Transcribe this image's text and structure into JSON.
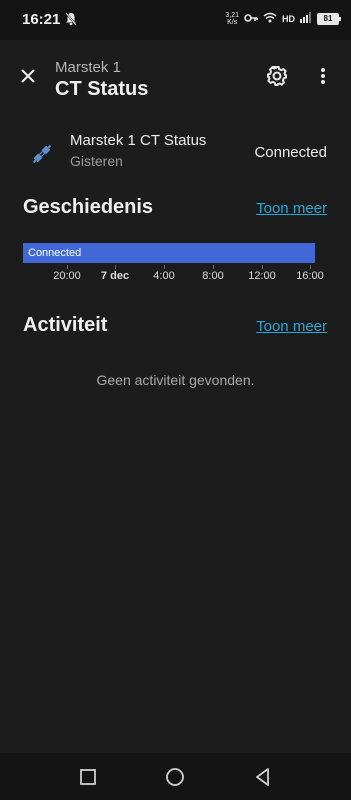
{
  "status_bar": {
    "time": "16:21",
    "speed_value": "3,21",
    "speed_unit": "K/s",
    "network": "HD",
    "battery": "81"
  },
  "header": {
    "subtitle": "Marstek 1",
    "title": "CT Status",
    "icons": [
      "close-icon",
      "gear-icon",
      "more-vert-icon"
    ]
  },
  "entity": {
    "name": "Marstek 1 CT Status",
    "last_changed": "Gisteren",
    "state": "Connected",
    "icon": "plug-connected-icon",
    "icon_color": "#5b8fc9"
  },
  "history": {
    "title": "Geschiedenis",
    "more_label": "Toon meer",
    "bar_label": "Connected",
    "bar_color": "#4267d6",
    "axis_labels": [
      "20:00",
      "7 dec",
      "4:00",
      "8:00",
      "12:00",
      "16:00"
    ]
  },
  "activity": {
    "title": "Activiteit",
    "more_label": "Toon meer",
    "empty_message": "Geen activiteit gevonden."
  },
  "nav": {
    "icons": [
      "recents-square-icon",
      "home-circle-icon",
      "back-triangle-icon"
    ]
  }
}
